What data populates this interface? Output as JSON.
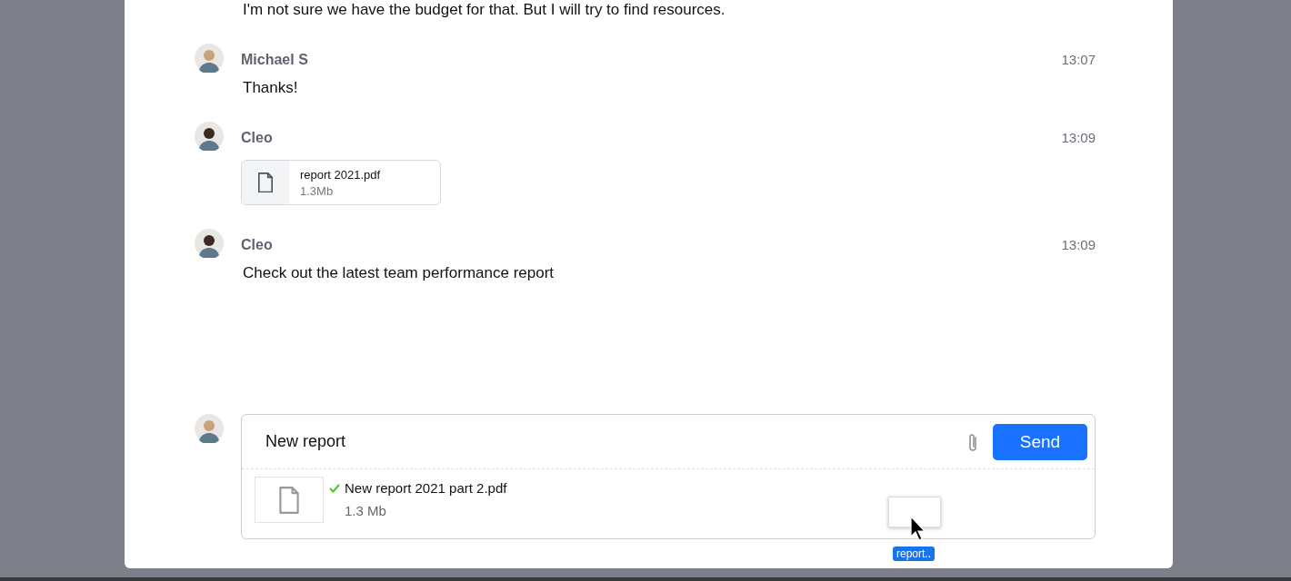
{
  "previous_text": "I'm not sure we have the budget for that. But I will try to find resources.",
  "messages": [
    {
      "kind": "text",
      "author": "Michael S",
      "time": "13:07",
      "text": "Thanks!"
    },
    {
      "kind": "file",
      "author": "Cleo",
      "time": "13:09",
      "file": {
        "name": "report 2021.pdf",
        "size": "1.3Mb"
      }
    },
    {
      "kind": "text",
      "author": "Cleo",
      "time": "13:09",
      "text": "Check out the latest team performance report"
    }
  ],
  "composer": {
    "value": "New report",
    "send_label": "Send",
    "attachment": {
      "name": "New report 2021 part 2.pdf",
      "size": "1.3 Mb",
      "uploaded": true
    }
  },
  "drag_preview": {
    "label": "report.."
  }
}
